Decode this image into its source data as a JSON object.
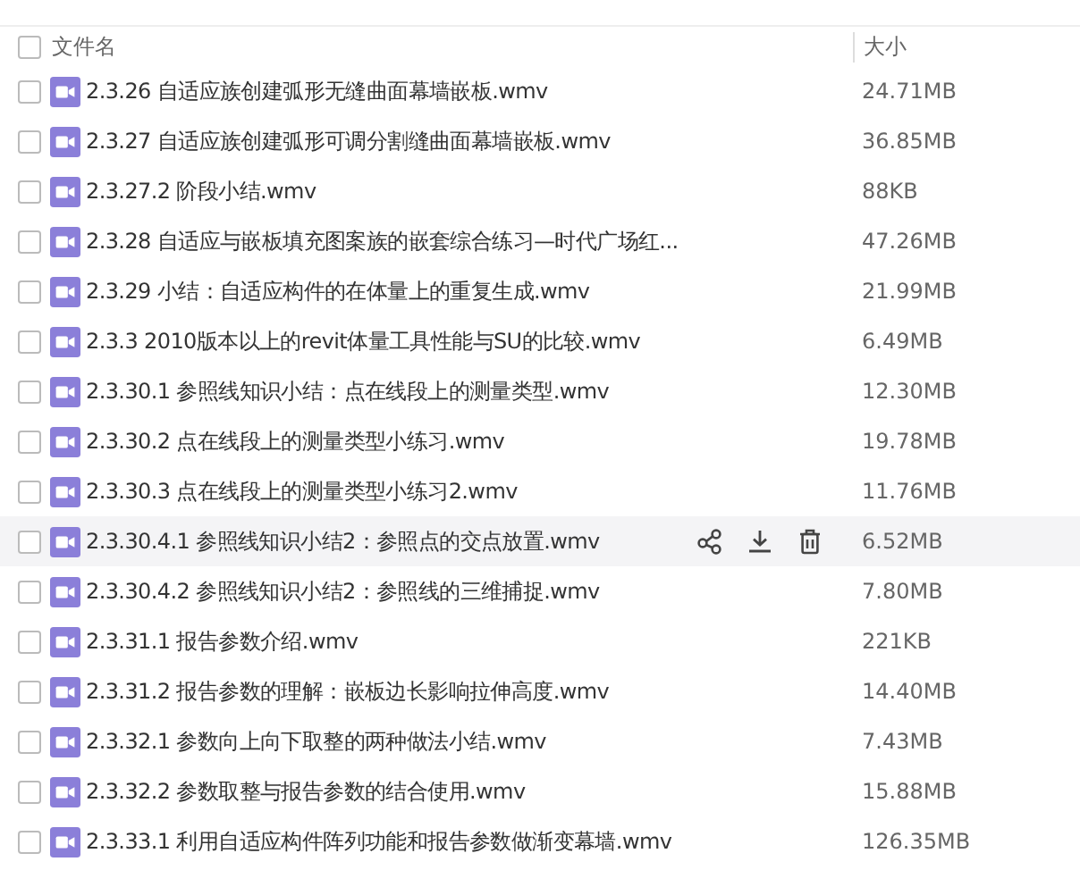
{
  "header": {
    "name_label": "文件名",
    "size_label": "大小",
    "select_all_checked": false
  },
  "files": [
    {
      "name": "2.3.26 自适应族创建弧形无缝曲面幕墙嵌板.wmv",
      "size": "24.71MB",
      "checked": false,
      "hovered": false
    },
    {
      "name": "2.3.27 自适应族创建弧形可调分割缝曲面幕墙嵌板.wmv",
      "size": "36.85MB",
      "checked": false,
      "hovered": false
    },
    {
      "name": "2.3.27.2 阶段小结.wmv",
      "size": "88KB",
      "checked": false,
      "hovered": false
    },
    {
      "name": "2.3.28 自适应与嵌板填充图案族的嵌套综合练习—时代广场红...",
      "size": "47.26MB",
      "checked": false,
      "hovered": false
    },
    {
      "name": "2.3.29 小结：自适应构件的在体量上的重复生成.wmv",
      "size": "21.99MB",
      "checked": false,
      "hovered": false
    },
    {
      "name": "2.3.3 2010版本以上的revit体量工具性能与SU的比较.wmv",
      "size": "6.49MB",
      "checked": false,
      "hovered": false
    },
    {
      "name": "2.3.30.1 参照线知识小结：点在线段上的测量类型.wmv",
      "size": "12.30MB",
      "checked": false,
      "hovered": false
    },
    {
      "name": "2.3.30.2 点在线段上的测量类型小练习.wmv",
      "size": "19.78MB",
      "checked": false,
      "hovered": false
    },
    {
      "name": "2.3.30.3 点在线段上的测量类型小练习2.wmv",
      "size": "11.76MB",
      "checked": false,
      "hovered": false
    },
    {
      "name": "2.3.30.4.1 参照线知识小结2：参照点的交点放置.wmv",
      "size": "6.52MB",
      "checked": false,
      "hovered": true
    },
    {
      "name": "2.3.30.4.2 参照线知识小结2：参照线的三维捕捉.wmv",
      "size": "7.80MB",
      "checked": false,
      "hovered": false
    },
    {
      "name": "2.3.31.1 报告参数介绍.wmv",
      "size": "221KB",
      "checked": false,
      "hovered": false
    },
    {
      "name": "2.3.31.2 报告参数的理解：嵌板边长影响拉伸高度.wmv",
      "size": "14.40MB",
      "checked": false,
      "hovered": false
    },
    {
      "name": "2.3.32.1 参数向上向下取整的两种做法小结.wmv",
      "size": "7.43MB",
      "checked": false,
      "hovered": false
    },
    {
      "name": "2.3.32.2 参数取整与报告参数的结合使用.wmv",
      "size": "15.88MB",
      "checked": false,
      "hovered": false
    },
    {
      "name": "2.3.33.1 利用自适应构件阵列功能和报告参数做渐变幕墙.wmv",
      "size": "126.35MB",
      "checked": false,
      "hovered": false
    }
  ]
}
